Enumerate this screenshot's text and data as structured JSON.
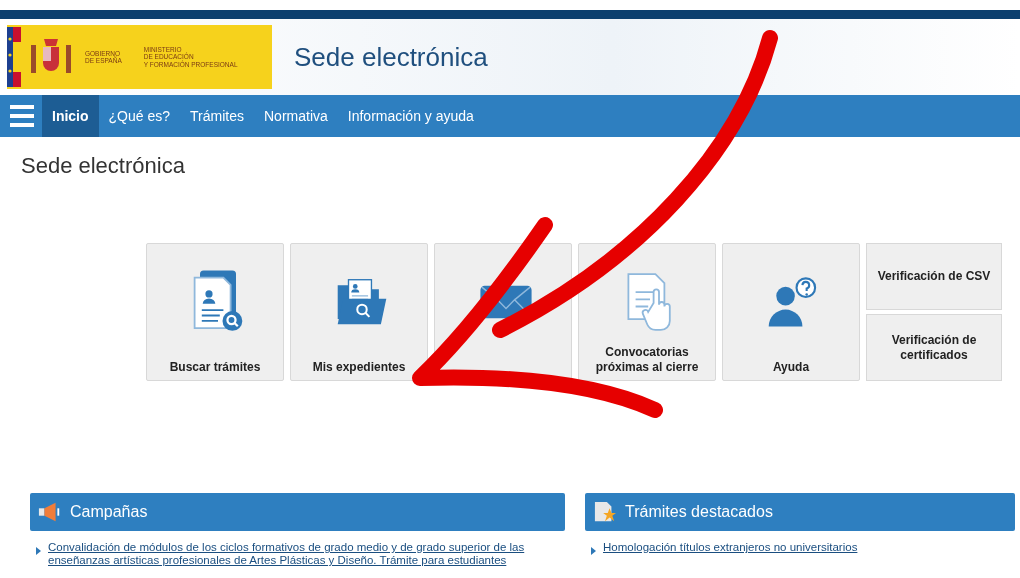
{
  "header": {
    "logo_gov": "GOBIERNO\nDE ESPAÑA",
    "logo_ministry": "MINISTERIO\nDE EDUCACIÓN\nY FORMACIÓN PROFESIONAL",
    "site_title": "Sede electrónica"
  },
  "nav": [
    {
      "label": "Inicio",
      "selected": true
    },
    {
      "label": "¿Qué es?",
      "selected": false
    },
    {
      "label": "Trámites",
      "selected": false
    },
    {
      "label": "Normativa",
      "selected": false
    },
    {
      "label": "Información y ayuda",
      "selected": false
    }
  ],
  "page_title": "Sede electrónica",
  "tiles": [
    {
      "kind": "search-doc",
      "label": "Buscar trámites"
    },
    {
      "kind": "folder",
      "label": "Mis expedientes"
    },
    {
      "kind": "mail"
    },
    {
      "kind": "hand-doc",
      "label": "Convocatorias próximas al cierre"
    },
    {
      "kind": "help",
      "label": "Ayuda"
    }
  ],
  "small_tiles": [
    "Verificación de CSV",
    "Verificación de certificados"
  ],
  "panels": [
    {
      "kind": "megaphone",
      "title": "Campañas",
      "links": [
        "Convalidación de módulos de los ciclos formativos de grado medio y de grado superior de las enseñanzas artísticas profesionales de Artes Plásticas y Diseño. Trámite para estudiantes"
      ]
    },
    {
      "kind": "star",
      "title": "Trámites destacados",
      "links": [
        "Homologación títulos extranjeros no universitarios"
      ]
    }
  ]
}
